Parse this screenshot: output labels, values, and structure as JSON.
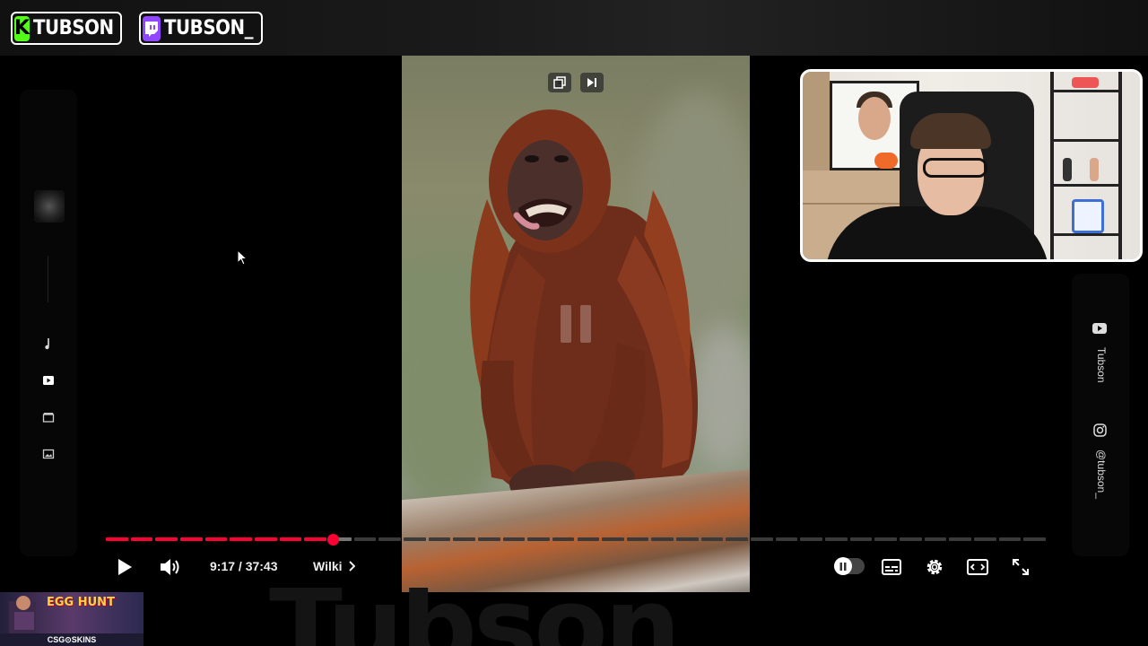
{
  "stream_overlay": {
    "kick_badge": {
      "name": "TUBSON",
      "logo": "K",
      "color": "#53fc18"
    },
    "twitch_badge": {
      "name": "TUBSON_",
      "color": "#9146ff"
    },
    "bottom_brand": "Tubson",
    "promo": {
      "title": "EGG HUNT",
      "sub": "CSG⊙SKINS"
    }
  },
  "left_sidebar": {
    "icons": [
      "music-note-icon",
      "video-icon",
      "clapperboard-icon",
      "image-icon"
    ]
  },
  "right_sidebar": {
    "youtube_label": "Tubson",
    "instagram_label": "@tubson_"
  },
  "player": {
    "current_time": "9:17",
    "duration": "37:43",
    "time_display": "9:17 / 37:43",
    "chapter": "Wilki",
    "progress_fraction": 0.2417,
    "buffered_fraction": 0.275,
    "accent_color": "#ff0033",
    "controls": [
      "play-icon",
      "volume-icon",
      "autoplay-toggle",
      "subtitles-icon",
      "settings-icon",
      "theater-mode-icon",
      "fullscreen-icon"
    ],
    "video_top_icons": [
      "copy-icon",
      "skip-next-icon"
    ]
  }
}
